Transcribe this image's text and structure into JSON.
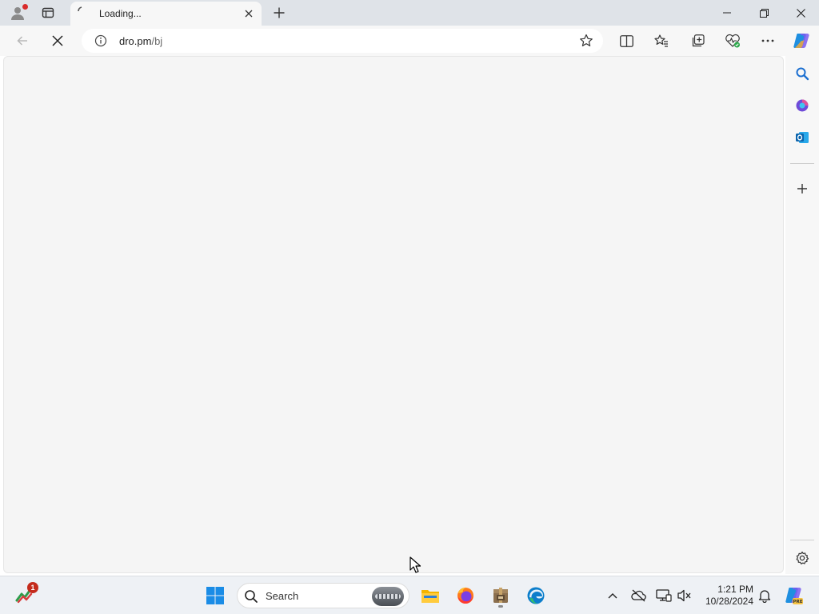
{
  "browser": {
    "tab": {
      "title": "Loading..."
    },
    "address_bar": {
      "host": "dro.pm",
      "path": "/bj"
    }
  },
  "taskbar": {
    "search": {
      "label": "Search"
    },
    "widgets_badge": "1",
    "clock": {
      "time": "1:21 PM",
      "date": "10/28/2024"
    }
  },
  "colors": {
    "edge_accent": "#0c7ecb",
    "windows_blue": "#1a8ce6",
    "outlook_blue": "#0a64ad",
    "badge_red": "#c42b1c"
  },
  "icons": {
    "title_bar": [
      "profile-icon",
      "tab-actions-icon",
      "new-tab-icon",
      "minimize-icon",
      "restore-icon",
      "close-window-icon"
    ],
    "toolbar": [
      "back-icon",
      "stop-loading-icon",
      "site-info-icon",
      "favorite-star-icon",
      "split-screen-icon",
      "favorites-icon",
      "collections-icon",
      "browser-essentials-icon",
      "more-icon",
      "copilot-icon"
    ],
    "sidebar": [
      "search-icon",
      "copilot-app-icon",
      "outlook-icon",
      "add-icon",
      "settings-icon"
    ],
    "taskbar": [
      "widgets-icon",
      "start-icon",
      "file-explorer-icon",
      "firefox-icon",
      "archive-app-icon",
      "edge-icon",
      "show-hidden-icons-icon",
      "onedrive-icon",
      "network-icon",
      "volume-icon",
      "notifications-icon",
      "copilot-pre-icon"
    ]
  }
}
